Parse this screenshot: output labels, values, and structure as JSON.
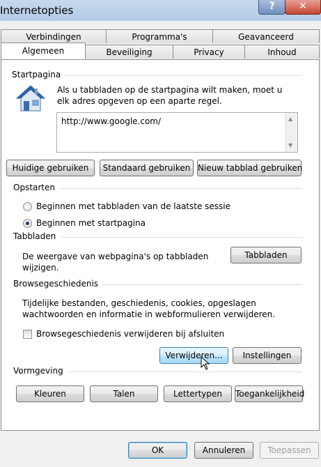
{
  "window": {
    "title": "Internetopties",
    "help_glyph": "?",
    "close_glyph": "✕"
  },
  "tabs": {
    "row1": [
      "Verbindingen",
      "Programma's",
      "Geavanceerd"
    ],
    "row2": [
      "Algemeen",
      "Beveiliging",
      "Privacy",
      "Inhoud"
    ],
    "active": "Algemeen"
  },
  "startpagina": {
    "label": "Startpagina",
    "description": "Als u tabbladen op de startpagina wilt maken, moet u elk adres opgeven op een aparte regel.",
    "url": "http://www.google.com/",
    "buttons": [
      "Huidige gebruiken",
      "Standaard gebruiken",
      "Nieuw tabblad gebruiken"
    ]
  },
  "opstarten": {
    "label": "Opstarten",
    "options": [
      "Beginnen met tabbladen van de laatste sessie",
      "Beginnen met startpagina"
    ],
    "selected": "Beginnen met startpagina"
  },
  "tabbladen": {
    "label": "Tabbladen",
    "description": "De weergave van webpagina's op tabbladen wijzigen.",
    "button": "Tabbladen"
  },
  "browsegeschiedenis": {
    "label": "Browsegeschiedenis",
    "description": "Tijdelijke bestanden, geschiedenis, cookies, opgeslagen wachtwoorden en informatie in webformulieren verwijderen.",
    "checkbox": "Browsegeschiedenis verwijderen bij afsluiten",
    "checked": false,
    "buttons": [
      "Verwijderen...",
      "Instellingen"
    ]
  },
  "vormgeving": {
    "label": "Vormgeving",
    "buttons": [
      "Kleuren",
      "Talen",
      "Lettertypen",
      "Toegankelijkheid"
    ]
  },
  "footer": {
    "ok": "OK",
    "cancel": "Annuleren",
    "apply": "Toepassen"
  },
  "colors": {
    "focus_border": "#3c7fb1",
    "panel_bg": "#ffffff",
    "dialog_bg": "#f0f0f0"
  },
  "icons": {
    "home": "house-icon",
    "cursor": "mouse-pointer-icon"
  }
}
